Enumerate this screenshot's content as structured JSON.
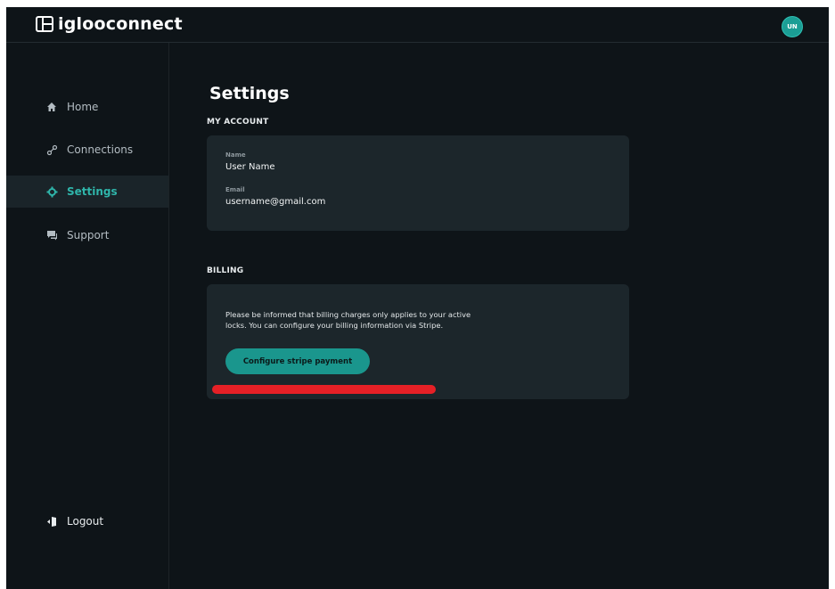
{
  "brand": {
    "name": "iglooconnect",
    "icon": "igloo-logo-icon"
  },
  "user": {
    "initials": "UN"
  },
  "sidebar": {
    "items": [
      {
        "label": "Home",
        "icon": "home-icon"
      },
      {
        "label": "Connections",
        "icon": "link-icon"
      },
      {
        "label": "Settings",
        "icon": "gear-icon",
        "active": true
      },
      {
        "label": "Support",
        "icon": "chat-icon"
      }
    ],
    "logout": {
      "label": "Logout",
      "icon": "door-icon"
    }
  },
  "main": {
    "title": "Settings",
    "account": {
      "heading": "MY ACCOUNT",
      "name_label": "Name",
      "name_value": "User Name",
      "email_label": "Email",
      "email_value": "username@gmail.com"
    },
    "billing": {
      "heading": "BILLING",
      "text_line1": "Please be informed that billing charges only applies to your active",
      "text_line2": "locks. You can configure your billing information via Stripe.",
      "button_label": "Configure stripe payment"
    }
  },
  "colors": {
    "background": "#0e1418",
    "card": "#1c262b",
    "accent": "#1a968d",
    "active_text": "#2fb5aa",
    "redaction": "#e52026"
  }
}
